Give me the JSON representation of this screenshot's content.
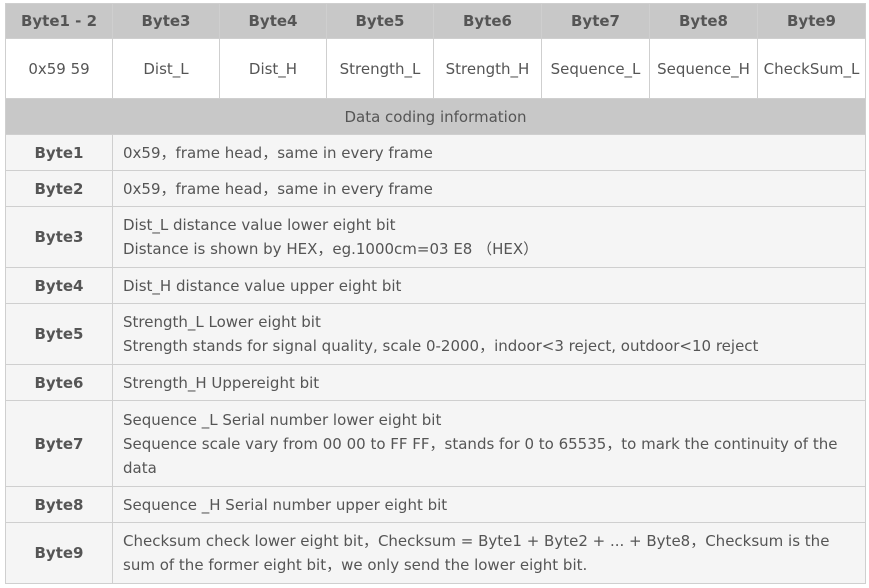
{
  "header": [
    "Byte1 - 2",
    "Byte3",
    "Byte4",
    "Byte5",
    "Byte6",
    "Byte7",
    "Byte8",
    "Byte9"
  ],
  "format_row": [
    "0x59 59",
    "Dist_L",
    "Dist_H",
    "Strength_L",
    "Strength_H",
    "Sequence_L",
    "Sequence_H",
    "CheckSum_L"
  ],
  "section_title": "Data coding information",
  "rows": [
    {
      "label": "Byte1",
      "lines": [
        "0x59，frame head，same in every frame"
      ]
    },
    {
      "label": "Byte2",
      "lines": [
        "0x59，frame head，same in every frame"
      ]
    },
    {
      "label": "Byte3",
      "lines": [
        "Dist_L distance value lower eight bit",
        "Distance is shown by HEX，eg.1000cm=03 E8 （HEX）"
      ]
    },
    {
      "label": "Byte4",
      "lines": [
        "Dist_H distance value upper eight bit"
      ]
    },
    {
      "label": "Byte5",
      "lines": [
        "Strength_L Lower eight bit",
        "Strength stands for signal quality, scale 0-2000，indoor<3 reject, outdoor<10 reject"
      ]
    },
    {
      "label": "Byte6",
      "lines": [
        "Strength_H Uppereight bit"
      ]
    },
    {
      "label": "Byte7",
      "lines": [
        "Sequence _L Serial number lower eight bit",
        "Sequence scale vary from 00 00 to FF FF，stands for 0 to 65535，to mark the continuity of the data"
      ]
    },
    {
      "label": "Byte8",
      "lines": [
        "Sequence _H Serial number upper eight bit"
      ]
    },
    {
      "label": "Byte9",
      "lines": [
        "Checksum check lower eight bit，Checksum = Byte1 + Byte2 + ... + Byte8，Checksum is the sum of the former eight bit，we only send the lower eight bit."
      ]
    }
  ]
}
